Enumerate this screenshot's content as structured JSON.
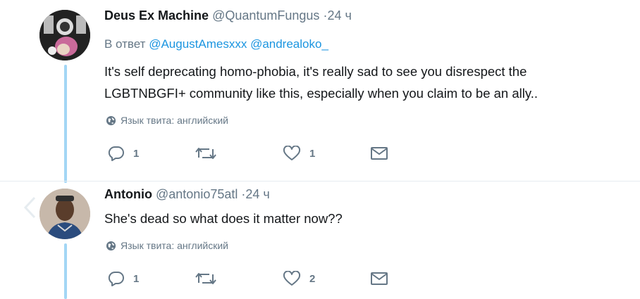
{
  "tweets": [
    {
      "name": "Deus Ex Machine",
      "handle": "@QuantumFungus",
      "time": "·24 ч",
      "reply_prefix": "В ответ",
      "mentions": [
        "@AugustAmesxxx",
        "@andrealoko_"
      ],
      "text_lines": [
        "It's self deprecating homo-phobia, it's really sad to see you disrespect the",
        "LGBTNBGFI+ community like this, especially when you claim to be an ally.."
      ],
      "lang_label": "Язык твита: английский",
      "reply_count": "1",
      "retweet_count": "",
      "like_count": "1"
    },
    {
      "name": "Antonio",
      "handle": "@antonio75atl",
      "time": "·24 ч",
      "text_lines": [
        "She's dead so what does it matter now??"
      ],
      "lang_label": "Язык твита: английский",
      "reply_count": "1",
      "retweet_count": "",
      "like_count": "2"
    }
  ],
  "icons": {
    "reply": "reply-icon",
    "retweet": "retweet-icon",
    "like": "heart-icon",
    "dm": "envelope-icon",
    "globe": "globe-icon",
    "nav": "chevron-left-icon"
  },
  "colors": {
    "thread_line": "#a3d6f5",
    "mention": "#1b95e0",
    "secondary_text": "#657786",
    "icon": "#657786"
  }
}
